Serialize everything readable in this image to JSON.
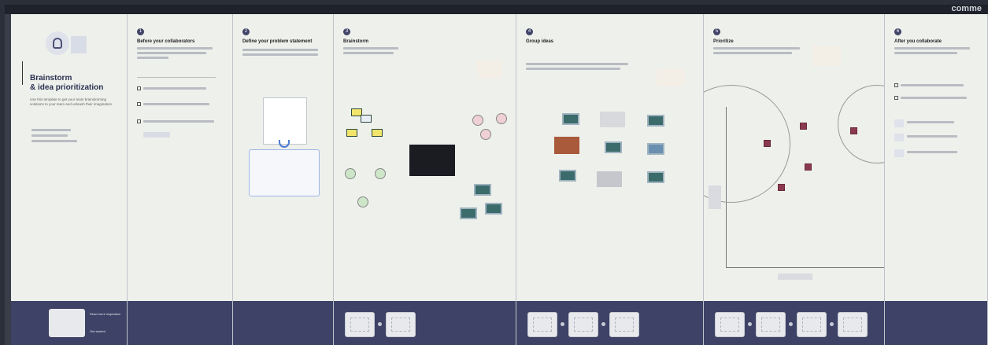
{
  "top_hint": "comme",
  "panel1": {
    "title_line1": "Brainstorm",
    "title_line2": "& idea prioritization",
    "intro": "Use this template to get your team brainstorming solutions to your team and unleash their imagination",
    "footer_title": "Read more inspiration",
    "footer_link": "Get started"
  },
  "panel2": {
    "num": "1",
    "title": "Before your collaborators"
  },
  "panel3": {
    "num": "2",
    "title": "Define your problem statement"
  },
  "panel4": {
    "num": "3",
    "title": "Brainstorm"
  },
  "panel5": {
    "num": "4",
    "title": "Group ideas"
  },
  "panel6": {
    "num": "5",
    "title": "Prioritize"
  },
  "panel7": {
    "num": "6",
    "title": "After you collaborate"
  },
  "colors": {
    "footer": "#3d4266",
    "card_teal": "#3b6b6b",
    "card_pink": "#8a3a4f",
    "note_yellow": "#f2e56b",
    "circle_green": "#cde6c8",
    "circle_pink": "#efd0d4"
  }
}
